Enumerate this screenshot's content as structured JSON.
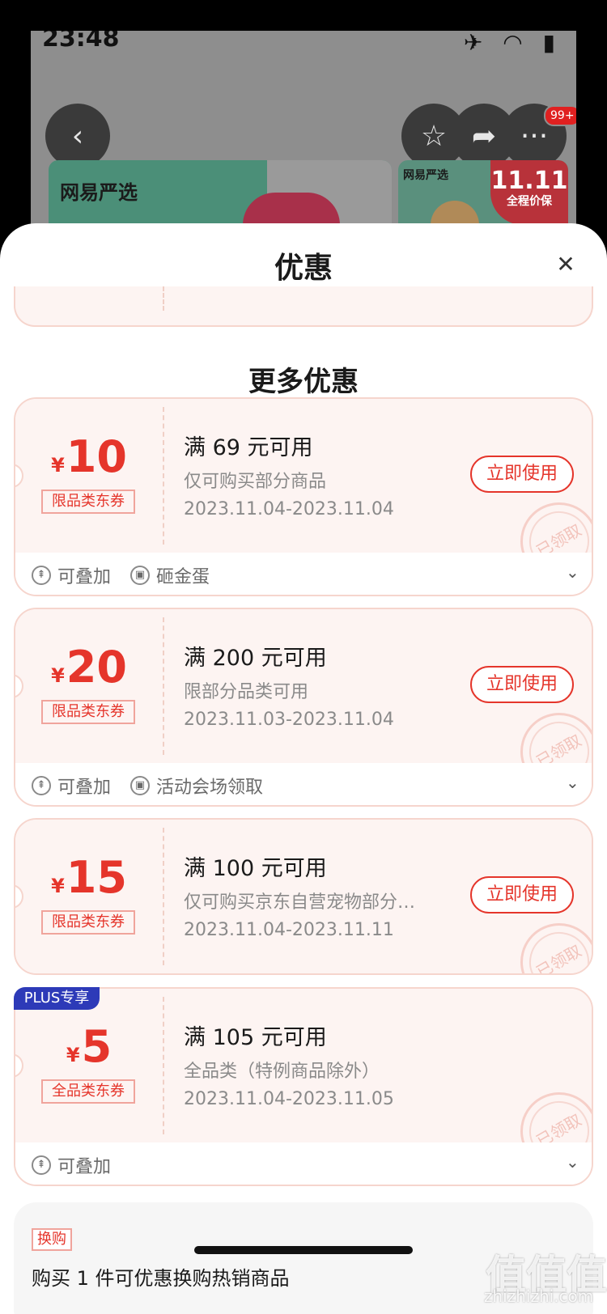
{
  "status": {
    "time": "23:48"
  },
  "background": {
    "notification_count": "99+",
    "card1_logo": "网易严选",
    "card2_logo": "网易严选",
    "card2_tag_big": "11.11",
    "card2_tag_small": "全程价保"
  },
  "sheet": {
    "title": "优惠",
    "section_title": "更多优惠"
  },
  "coupons": [
    {
      "yen": "¥",
      "amount": "10",
      "category": "限品类东券",
      "title": "满 69 元可用",
      "desc": "仅可购买部分商品",
      "date": "2023.11.04-2023.11.04",
      "button": "立即使用",
      "stamp": "已领取",
      "tags": [
        "可叠加",
        "砸金蛋"
      ]
    },
    {
      "yen": "¥",
      "amount": "20",
      "category": "限品类东券",
      "title": "满 200 元可用",
      "desc": "限部分品类可用",
      "date": "2023.11.03-2023.11.04",
      "button": "立即使用",
      "stamp": "已领取",
      "tags": [
        "可叠加",
        "活动会场领取"
      ]
    },
    {
      "yen": "¥",
      "amount": "15",
      "category": "限品类东券",
      "title": "满 100 元可用",
      "desc": "仅可购买京东自营宠物部分…",
      "date": "2023.11.04-2023.11.11",
      "button": "立即使用",
      "stamp": "已领取",
      "tags": []
    },
    {
      "badge": "PLUS专享",
      "yen": "¥",
      "amount": "5",
      "category": "全品类东券",
      "title": "满 105 元可用",
      "desc": "全品类（特例商品除外）",
      "date": "2023.11.04-2023.11.05",
      "stamp": "已领取",
      "tags": [
        "可叠加"
      ]
    }
  ],
  "exchange": {
    "tag": "换购",
    "text": "购买 1 件可优惠换购热销商品"
  },
  "watermark": {
    "mark": "值值值",
    "site": "zhizhizhi.com"
  },
  "icons": {
    "back": "chevron-left-icon",
    "star": "star-icon",
    "share": "share-icon",
    "more": "more-icon",
    "close": "close-icon",
    "stack": "stack-icon",
    "coupon": "ticket-icon",
    "expand": "chevron-down-icon"
  }
}
